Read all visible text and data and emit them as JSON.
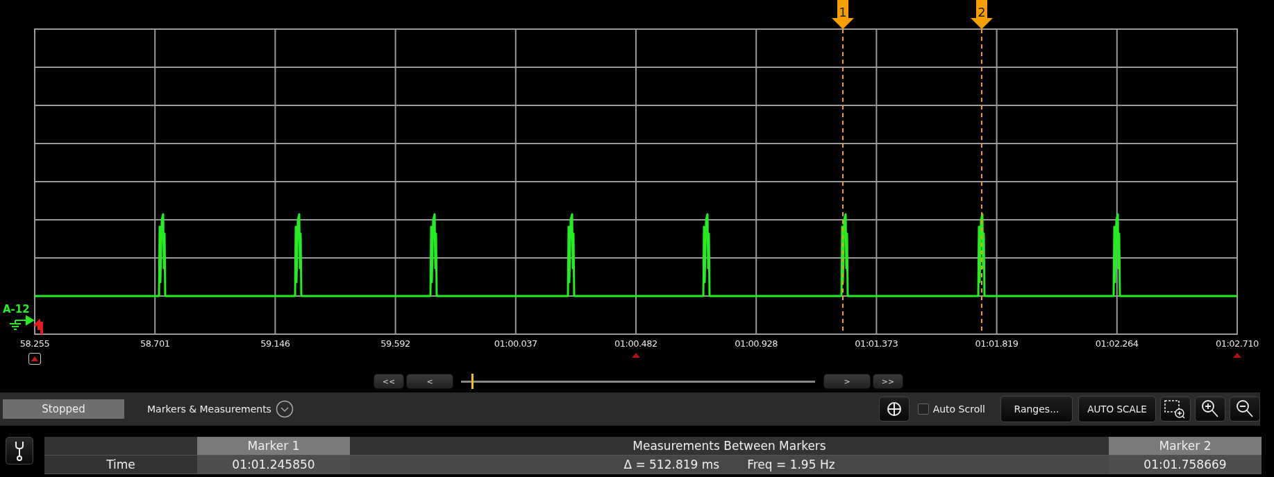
{
  "chart": {
    "channel_label": "A-12",
    "x_labels": [
      "58.255",
      "58.701",
      "59.146",
      "59.592",
      "01:00.037",
      "01:00.482",
      "01:00.928",
      "01:01.373",
      "01:01.819",
      "01:02.264",
      "01:02.710"
    ],
    "markers": [
      {
        "label": "1"
      },
      {
        "label": "2"
      }
    ]
  },
  "navigation": {
    "back_buttons": [
      "<<",
      "<"
    ],
    "forward_buttons": [
      ">",
      ">>"
    ],
    "position": {
      "level": 0.03
    }
  },
  "toolbar": {
    "status": "Stopped",
    "panel_title": "Markers & Measurements",
    "auto_scroll": {
      "label": "Auto Scroll",
      "checked": false
    },
    "buttons": [
      "Ranges...",
      "AUTO SCALE"
    ]
  },
  "table": {
    "headers": {
      "marker_1": "Marker 1",
      "between": "Measurements Between Markers",
      "marker_2": "Marker 2"
    },
    "rows": [
      {
        "label": "Time",
        "marker_1": "01:01.245850",
        "delta": "Δ = 512.819 ms",
        "frequency": "Freq = 1.95 Hz",
        "marker_2": "01:01.758669"
      }
    ]
  }
}
